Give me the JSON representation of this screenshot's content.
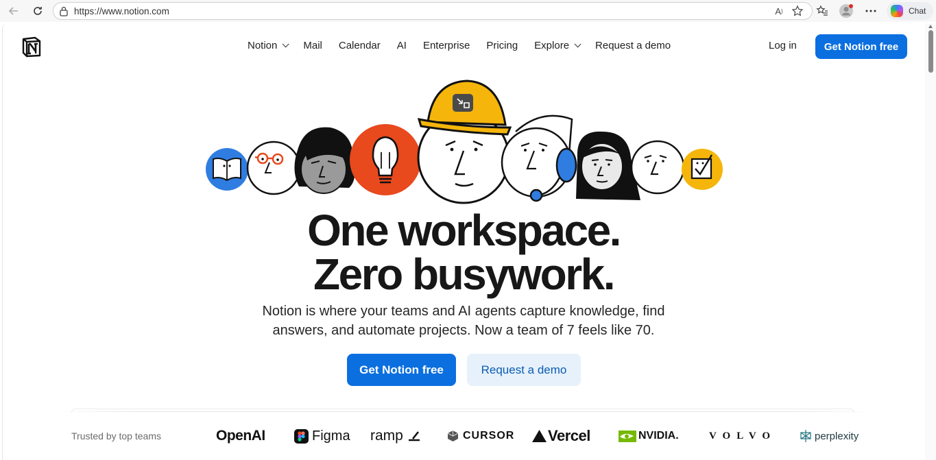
{
  "browser": {
    "url": "https://www.notion.com",
    "chat_label": "Chat"
  },
  "header": {
    "nav_items": [
      {
        "label": "Notion",
        "has_dropdown": true
      },
      {
        "label": "Mail",
        "has_dropdown": false
      },
      {
        "label": "Calendar",
        "has_dropdown": false
      },
      {
        "label": "AI",
        "has_dropdown": false
      },
      {
        "label": "Enterprise",
        "has_dropdown": false
      },
      {
        "label": "Pricing",
        "has_dropdown": false
      },
      {
        "label": "Explore",
        "has_dropdown": true
      },
      {
        "label": "Request a demo",
        "has_dropdown": false
      }
    ],
    "login_label": "Log in",
    "cta_label": "Get Notion free"
  },
  "hero": {
    "headline_line1": "One workspace.",
    "headline_line2": "Zero busywork.",
    "subtitle_line1": "Notion is where your teams and AI agents capture knowledge, find",
    "subtitle_line2": "answers, and automate projects. Now a team of 7 feels like 70.",
    "primary_cta": "Get Notion free",
    "secondary_cta": "Request a demo"
  },
  "trusted": {
    "label": "Trusted by top teams",
    "logos": [
      "OpenAI",
      "Figma",
      "ramp",
      "CURSOR",
      "Vercel",
      "NVIDIA.",
      "VOLVO",
      "perplexity"
    ]
  },
  "colors": {
    "accent": "#0b6fe0",
    "accent_soft": "#e6f1fb",
    "illustration_blue": "#2f7de1",
    "illustration_orange": "#e8491d",
    "illustration_yellow": "#f5b50a"
  }
}
